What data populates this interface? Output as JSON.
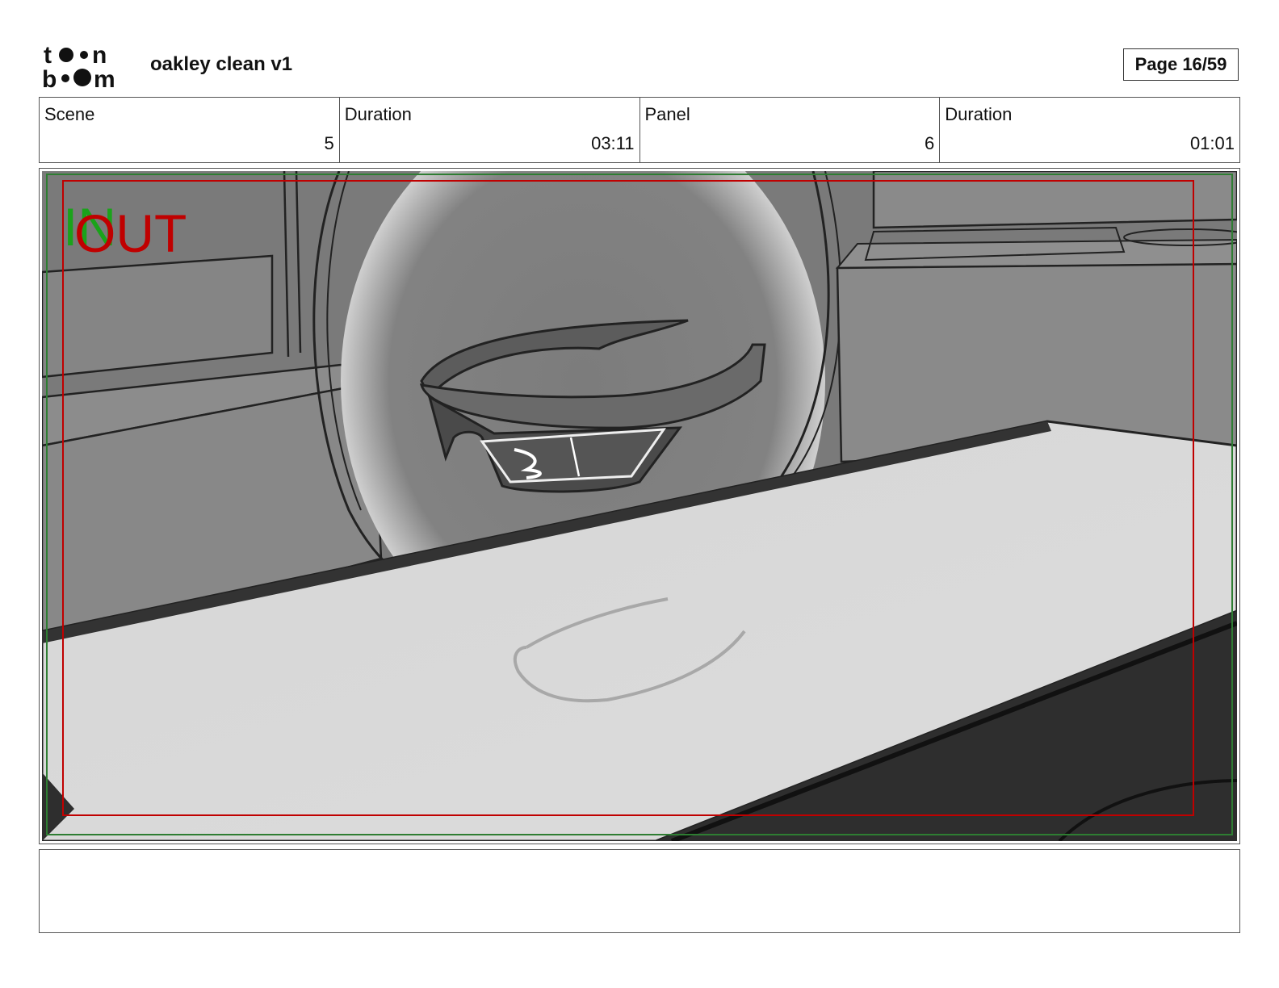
{
  "header": {
    "logo_text": "toon boom",
    "title": "oakley clean v1",
    "page": "Page 16/59"
  },
  "info": [
    {
      "label": "Scene",
      "value": "5"
    },
    {
      "label": "Duration",
      "value": "03:11"
    },
    {
      "label": "Panel",
      "value": "6"
    },
    {
      "label": "Duration",
      "value": "01:01"
    }
  ],
  "panel": {
    "marker_in": "IN",
    "marker_out": "OUT",
    "image": "storyboard-sketch-sunglasses-above-table"
  },
  "notes": {
    "text": ""
  },
  "colors": {
    "safe_frame_green": "#2e7d32",
    "action_frame_red": "#c00000"
  }
}
